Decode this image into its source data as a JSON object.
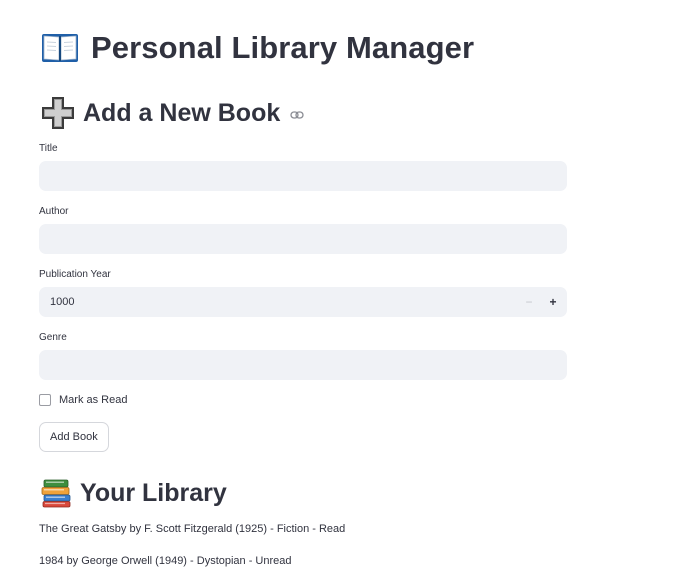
{
  "app": {
    "title": "Personal Library Manager",
    "title_icon": "book-icon"
  },
  "add_section": {
    "heading": "Add a New Book",
    "heading_icon": "plus-icon",
    "anchor_icon": "link-icon",
    "fields": {
      "title": {
        "label": "Title",
        "value": "",
        "placeholder": ""
      },
      "author": {
        "label": "Author",
        "value": "",
        "placeholder": ""
      },
      "year": {
        "label": "Publication Year",
        "value": "1000",
        "minus": "−",
        "plus": "+"
      },
      "genre": {
        "label": "Genre",
        "value": "",
        "placeholder": ""
      }
    },
    "mark_as_read": {
      "label": "Mark as Read",
      "checked": false
    },
    "submit_label": "Add Book"
  },
  "library_section": {
    "heading": "Your Library",
    "heading_icon": "books-icon",
    "books": [
      "The Great Gatsby by F. Scott Fitzgerald (1925) - Fiction - Read",
      "1984 by George Orwell (1949) - Dystopian - Unread"
    ]
  },
  "colors": {
    "text": "#31333f",
    "input_bg": "#f0f2f6",
    "button_border": "#d5d7dc"
  }
}
